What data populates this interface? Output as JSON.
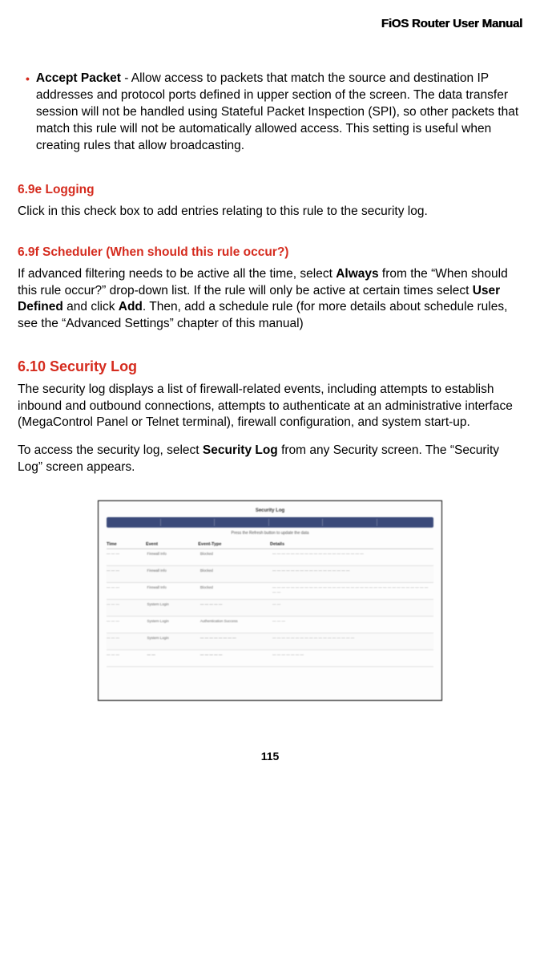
{
  "header": {
    "title": "FiOS Router User Manual"
  },
  "bullet": {
    "lead": "Accept Packet",
    "body": " - Allow access to packets that match the source and destination IP addresses and protocol ports defined in upper section of the screen. The data transfer session will not be handled using Stateful Packet Inspection (SPI), so other packets that match this rule will not be automatically allowed access. This setting is useful when creating rules that allow broadcasting."
  },
  "s69e": {
    "heading": "6.9e  Logging",
    "body": "Click in this check box to add entries relating to this rule to the security log."
  },
  "s69f": {
    "heading": "6.9f  Scheduler (When should this rule occur?)",
    "p1a": "If advanced filtering needs to be active all the time, select ",
    "p1b": "Always",
    "p1c": " from the “When should this rule occur?” drop-down list. If the rule will only be active at certain times select ",
    "p1d": "User Defined",
    "p1e": " and click ",
    "p1f": "Add",
    "p1g": ". Then, add a schedule rule (for more details about schedule rules, see the “Advanced Settings” chapter of this manual)"
  },
  "s610": {
    "heading": "6.10  Security Log",
    "p1": "The security log displays a list of firewall-related events, including attempts to establish inbound and outbound connections, attempts to authenticate at an administrative interface (MegaControl Panel or Telnet terminal), firewall configuration, and system start-up.",
    "p2a": "To access the security log, select ",
    "p2b": "Security Log",
    "p2c": " from any Security screen. The “Security Log” screen appears."
  },
  "figure": {
    "title": "Security Log",
    "desc": "Press the Refresh button to update the data",
    "headers": {
      "c1": "Time",
      "c2": "Event",
      "c3": "Event-Type",
      "c4": "Details"
    },
    "rows": [
      {
        "c1": "— — —",
        "c2": "Firewall Info",
        "c3": "Blocked",
        "c4": "— — — — — — — — — — — — — — — — — — — —"
      },
      {
        "c1": "— — —",
        "c2": "Firewall Info",
        "c3": "Blocked",
        "c4": "— — — — — — — — — —\n— — — — — — —"
      },
      {
        "c1": "— — —",
        "c2": "Firewall Info",
        "c3": "Blocked",
        "c4": "— — — — — — — — — — — — — — — — —\n— — — — — — — — — — — — — — — — — — —"
      },
      {
        "c1": "— — —",
        "c2": "System\nLogin",
        "c3": "— — — — —",
        "c4": "— —"
      },
      {
        "c1": "— — —",
        "c2": "System\nLogin",
        "c3": "Authentication\nSuccess",
        "c4": "— — —"
      },
      {
        "c1": "— — —",
        "c2": "System\nLogin",
        "c3": "— — — — — — — —",
        "c4": "— — — — — — — — — — — — — — — — — —"
      },
      {
        "c1": "— — —",
        "c2": "— —",
        "c3": "— — — — —",
        "c4": "— — — — — — —"
      }
    ]
  },
  "page": "115"
}
